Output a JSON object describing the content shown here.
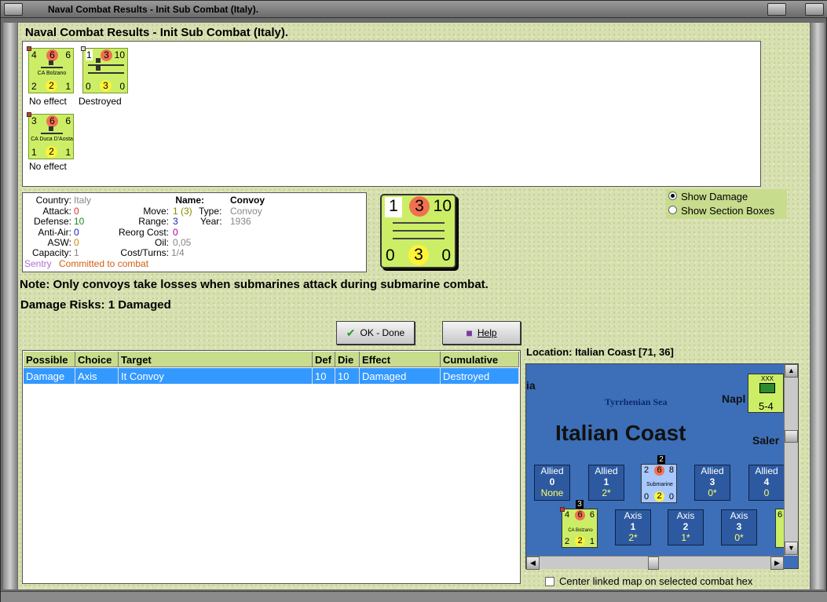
{
  "window": {
    "title": "Naval Combat Results - Init Sub Combat (Italy)."
  },
  "heading": "Naval Combat Results - Init Sub Combat (Italy).",
  "results": [
    {
      "name": "CA Bolzano",
      "tl": "4",
      "tc": "6",
      "tr": "6",
      "bl": "2",
      "bc": "2",
      "br": "1",
      "effect": "No effect"
    },
    {
      "name": "",
      "tl": "1",
      "tc": "3",
      "tr": "10",
      "bl": "0",
      "bc": "3",
      "br": "0",
      "effect": "Destroyed"
    },
    {
      "name": "CA Duca D'Aosta",
      "tl": "3",
      "tc": "6",
      "tr": "6",
      "bl": "1",
      "bc": "2",
      "br": "1",
      "effect": "No effect"
    }
  ],
  "info": {
    "country_label": "Country:",
    "country": "Italy",
    "attack_label": "Attack:",
    "attack": "0",
    "defense_label": "Defense:",
    "defense": "10",
    "antiair_label": "Anti-Air:",
    "antiair": "0",
    "asw_label": "ASW:",
    "asw": "0",
    "capacity_label": "Capacity:",
    "capacity": "1",
    "sentry": "Sentry",
    "committed": "Committed to combat",
    "move_label": "Move:",
    "move": "1 (3)",
    "range_label": "Range:",
    "range": "3",
    "reorg_label": "Reorg Cost:",
    "reorg": "0",
    "oil_label": "Oil:",
    "oil": "0,05",
    "cost_label": "Cost/Turns:",
    "cost": "1/4",
    "name_label": "Name:",
    "name": "Convoy",
    "type_label": "Type:",
    "type": "Convoy",
    "year_label": "Year:",
    "year": "1936"
  },
  "counter": {
    "tl": "1",
    "tc": "3",
    "tr": "10",
    "bl": "0",
    "bc": "3",
    "br": "0"
  },
  "options": {
    "show_damage": "Show Damage",
    "show_section": "Show Section Boxes"
  },
  "note": "Note: Only convoys take losses when submarines attack during submarine combat.",
  "damage_risks": "Damage Risks:  1 Damaged",
  "buttons": {
    "ok": "OK - Done",
    "help": "Help"
  },
  "table": {
    "headers": [
      "Possible",
      "Choice",
      "Target",
      "Def",
      "Die",
      "Effect",
      "Cumulative"
    ],
    "rows": [
      [
        "Damage",
        "Axis",
        "It Convoy",
        "10",
        "10",
        "Damaged",
        "Destroyed"
      ]
    ]
  },
  "location": "Location:  Italian Coast [71, 36]",
  "map": {
    "sea": "Tyrrhenian Sea",
    "coast": "Italian Coast",
    "napl": "Napl",
    "saler": "Saler",
    "ia": "ia",
    "corps_value": "5-4",
    "corps_size": "XXX",
    "allied_boxes": [
      {
        "side": "Allied",
        "num": "0",
        "val": "None"
      },
      {
        "side": "Allied",
        "num": "1",
        "val": "2*"
      },
      {
        "side": "Allied",
        "num": "3",
        "val": "0*"
      },
      {
        "side": "Allied",
        "num": "4",
        "val": "0"
      }
    ],
    "axis_boxes": [
      {
        "side": "Axis",
        "num": "1",
        "val": "2*"
      },
      {
        "side": "Axis",
        "num": "2",
        "val": "1*"
      },
      {
        "side": "Axis",
        "num": "3",
        "val": "0*"
      }
    ],
    "sub": {
      "name": "Submarine",
      "stack": "2",
      "tl": "2",
      "tc": "6",
      "tr": "8",
      "bl": "0",
      "bc": "2",
      "br": "0"
    },
    "bolzano": {
      "name": "CA Bolzano",
      "stack": "3",
      "tl": "4",
      "tc": "6",
      "tr": "6",
      "bl": "2",
      "bc": "2",
      "br": "1"
    },
    "edge_unit": "6"
  },
  "center_linked": "Center linked map on selected combat hex"
}
